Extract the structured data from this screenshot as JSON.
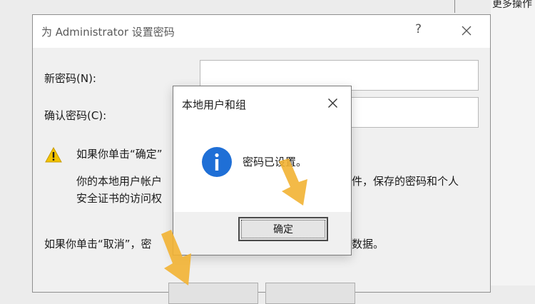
{
  "background_window": {
    "more_actions": "更多操作"
  },
  "password_dialog": {
    "title": "为 Administrator 设置密码",
    "help_glyph": "?",
    "new_password_label": "新密码(N):",
    "confirm_password_label": "确认密码(C):",
    "warning_line1": "如果你单击“确定”",
    "warning_line2_left": "你的本地用户帐户",
    "warning_line2_right": "件，保存的密码和个人",
    "warning_line3": "安全证书的访问权",
    "cancel_note_left": "如果你单击“取消”，密",
    "cancel_note_right": "数据。"
  },
  "message_box": {
    "title": "本地用户和组",
    "message": "密码已设置。",
    "ok_label": "确定"
  },
  "colors": {
    "info_blue": "#1f6fd6",
    "warning_yellow": "#f3c300",
    "arrow_orange": "#f2b233"
  }
}
